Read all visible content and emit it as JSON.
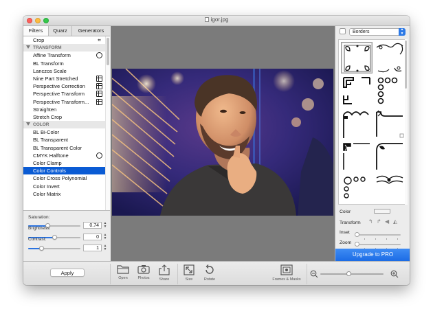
{
  "window": {
    "title": "igor.jpg"
  },
  "tabs": [
    "Filters",
    "Quarz",
    "Generators"
  ],
  "filters": [
    {
      "label": "Crop",
      "type": "item",
      "icon": "crop"
    },
    {
      "label": "TRANSFORM",
      "type": "header"
    },
    {
      "label": "Affine Transform",
      "type": "item",
      "icon": "dial"
    },
    {
      "label": "BL Transform",
      "type": "item"
    },
    {
      "label": "Lanczos Scale",
      "type": "item"
    },
    {
      "label": "Nine Part Stretched",
      "type": "item",
      "icon": "grid"
    },
    {
      "label": "Perspective Correction",
      "type": "item",
      "icon": "grid"
    },
    {
      "label": "Perspective Transform",
      "type": "item",
      "icon": "grid"
    },
    {
      "label": "Perspective Transform...",
      "type": "item",
      "icon": "grid"
    },
    {
      "label": "Straighten",
      "type": "item"
    },
    {
      "label": "Stretch Crop",
      "type": "item"
    },
    {
      "label": "COLOR",
      "type": "header"
    },
    {
      "label": "BL Bi-Color",
      "type": "item"
    },
    {
      "label": "BL Transparent",
      "type": "item"
    },
    {
      "label": "BL Transparent Color",
      "type": "item"
    },
    {
      "label": "CMYK Halftone",
      "type": "item",
      "icon": "dial"
    },
    {
      "label": "Color Clamp",
      "type": "item"
    },
    {
      "label": "Color Controls",
      "type": "item",
      "selected": true
    },
    {
      "label": "Color Cross Polynomial",
      "type": "item"
    },
    {
      "label": "Color Invert",
      "type": "item"
    },
    {
      "label": "Color Matrix",
      "type": "item"
    }
  ],
  "params": {
    "saturation": {
      "label": "Saturation:",
      "value": "0.74",
      "level": 0.37
    },
    "brightness": {
      "label": "Brightness:",
      "value": "0",
      "level": 0.5
    },
    "contrast": {
      "label": "Contrast:",
      "value": "1",
      "level": 0.25
    }
  },
  "right_panel": {
    "category": "Borders",
    "color_label": "Color",
    "transform_label": "Transform",
    "inset_label": "Inset",
    "zoom_label": "Zoom",
    "upgrade_label": "Upgrade to PRO"
  },
  "bottom": {
    "apply_label": "Apply",
    "tools": [
      "Open",
      "Photos",
      "Share",
      "Size",
      "Rotate",
      "Frames & Masks"
    ],
    "zoom_level": 0.45
  },
  "colors": {
    "selection": "#0a5bd4",
    "accent": "#2c79e6",
    "canvas_bg": "#7b7b7b"
  }
}
